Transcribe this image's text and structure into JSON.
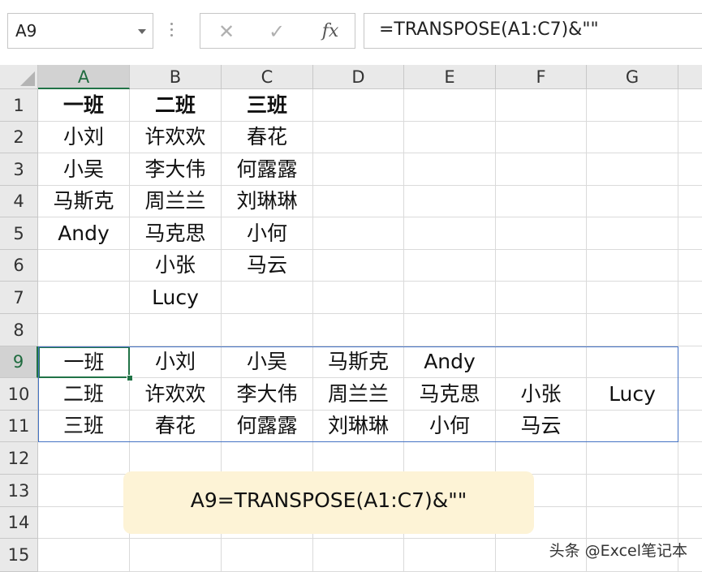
{
  "formula_bar": {
    "name_box": "A9",
    "cancel_icon": "close-icon",
    "enter_icon": "check-icon",
    "fx_label": "fx",
    "formula": "=TRANSPOSE(A1:C7)&\"\""
  },
  "sheet": {
    "columns": [
      "A",
      "B",
      "C",
      "D",
      "E",
      "F",
      "G"
    ],
    "rows": [
      "1",
      "2",
      "3",
      "4",
      "5",
      "6",
      "7",
      "8",
      "9",
      "10",
      "11",
      "12",
      "13",
      "14",
      "15"
    ],
    "selected_column": "A",
    "selected_row": "9",
    "active_cell": "A9",
    "cells": [
      [
        "一班",
        "二班",
        "三班",
        "",
        "",
        "",
        ""
      ],
      [
        "小刘",
        "许欢欢",
        "春花",
        "",
        "",
        "",
        ""
      ],
      [
        "小吴",
        "李大伟",
        "何露露",
        "",
        "",
        "",
        ""
      ],
      [
        "马斯克",
        "周兰兰",
        "刘琳琳",
        "",
        "",
        "",
        ""
      ],
      [
        "Andy",
        "马克思",
        "小何",
        "",
        "",
        "",
        ""
      ],
      [
        "",
        "小张",
        "马云",
        "",
        "",
        "",
        ""
      ],
      [
        "",
        "Lucy",
        "",
        "",
        "",
        "",
        ""
      ],
      [
        "",
        "",
        "",
        "",
        "",
        "",
        ""
      ],
      [
        "一班",
        "小刘",
        "小吴",
        "马斯克",
        "Andy",
        "",
        ""
      ],
      [
        "二班",
        "许欢欢",
        "李大伟",
        "周兰兰",
        "马克思",
        "小张",
        "Lucy"
      ],
      [
        "三班",
        "春花",
        "何露露",
        "刘琳琳",
        "小何",
        "马云",
        ""
      ],
      [
        "",
        "",
        "",
        "",
        "",
        "",
        ""
      ],
      [
        "",
        "",
        "",
        "",
        "",
        "",
        ""
      ],
      [
        "",
        "",
        "",
        "",
        "",
        "",
        ""
      ],
      [
        "",
        "",
        "",
        "",
        "",
        "",
        ""
      ]
    ]
  },
  "annotation": "A9=TRANSPOSE(A1:C7)&\"\"",
  "watermark": "头条 @Excel笔记本",
  "colors": {
    "accent_green": "#217346",
    "range_blue": "#4472c4",
    "note_bg": "#fdf3d6"
  }
}
